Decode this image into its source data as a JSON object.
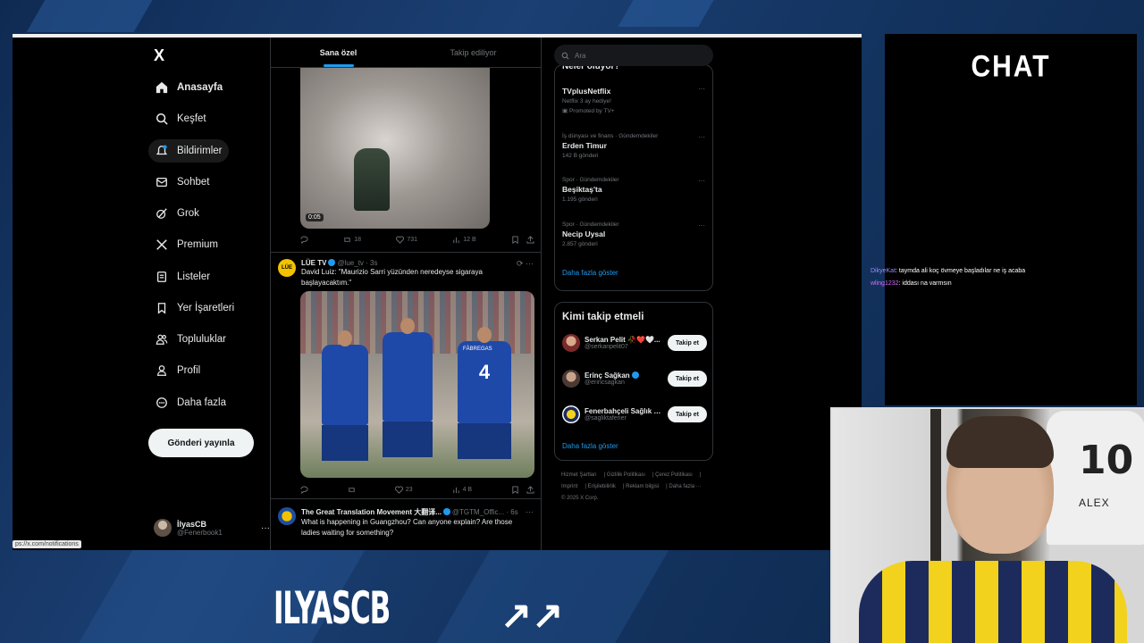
{
  "nav": {
    "logo": "X",
    "items": [
      {
        "label": "Anasayfa",
        "icon": "home-icon"
      },
      {
        "label": "Keşfet",
        "icon": "search-icon"
      },
      {
        "label": "Bildirimler",
        "icon": "bell-icon"
      },
      {
        "label": "Sohbet",
        "icon": "mail-icon"
      },
      {
        "label": "Grok",
        "icon": "grok-icon"
      },
      {
        "label": "Premium",
        "icon": "x-icon"
      },
      {
        "label": "Listeler",
        "icon": "list-icon"
      },
      {
        "label": "Yer İşaretleri",
        "icon": "bookmark-icon"
      },
      {
        "label": "Topluluklar",
        "icon": "people-icon"
      },
      {
        "label": "Profil",
        "icon": "person-icon"
      },
      {
        "label": "Daha fazla",
        "icon": "more-circle-icon"
      }
    ],
    "post_button": "Gönderi yayınla",
    "profile": {
      "name": "İlyasCB",
      "handle": "@Fenerbook1",
      "more": "···"
    }
  },
  "status_url": "ps://x.com/notifications",
  "feed": {
    "tabs": [
      {
        "label": "Sana özel",
        "active": true
      },
      {
        "label": "Takip ediliyor",
        "active": false
      }
    ],
    "tweet1": {
      "video_time": "0:05",
      "reply": "",
      "retweets": "18",
      "likes": "731",
      "views": "12 B"
    },
    "tweet2": {
      "name": "LÜE TV",
      "avatar_text": "LÜE",
      "handle_time": "@lue_tv · 3s",
      "text": "David Luiz: \"Maurizio Sarri yüzünden neredeyse sigaraya başlayacaktım.\"",
      "jersey": "4",
      "jersey_name": "FÀBREGAS",
      "retweets": "",
      "likes": "23",
      "views": "4 B"
    },
    "tweet3": {
      "name": "The Great Translation Movement 大翻译...",
      "handle_time": "@TGTM_Offic... · 6s",
      "text": "What is happening in Guangzhou? Can anyone explain? Are those ladies waiting for something?"
    }
  },
  "right": {
    "search_placeholder": "Ara",
    "trends_title": "Neler oluyor?",
    "trends": [
      {
        "category": "",
        "name": "TVplusNetflix",
        "count": "Netflix 3 ay hediye!",
        "promo": "Promoted by TV+"
      },
      {
        "category": "İş dünyası ve finans · Gündemdekiler",
        "name": "Erden Timur",
        "count": "142 B gönderi"
      },
      {
        "category": "Spor · Gündemdekiler",
        "name": "Beşiktaş'ta",
        "count": "1.195 gönderi"
      },
      {
        "category": "Spor · Gündemdekiler",
        "name": "Necip Uysal",
        "count": "2.857 gönderi"
      }
    ],
    "trends_more": "Daha fazla göster",
    "follow_title": "Kimi takip etmeli",
    "follow": [
      {
        "name": "Serkan Pelit 🥀❤️🤍...",
        "handle": "@serkanpelit07",
        "button": "Takip et"
      },
      {
        "name": "Erinç Sağkan",
        "handle": "@erincsagkan",
        "button": "Takip et"
      },
      {
        "name": "Fenerbahçeli Sağlık Ç...",
        "handle": "@sagliktafener",
        "button": "Takip et"
      }
    ],
    "follow_more": "Daha fazla göster",
    "footer": [
      "Hizmet Şartları",
      "Gizlilik Politikası",
      "Çerez Politikası",
      "Imprint",
      "Erişilebilirlik",
      "Reklam bilgisi",
      "Daha fazla ···",
      "© 2025 X Corp."
    ]
  },
  "chat": {
    "title": "CHAT",
    "messages": [
      {
        "user": "DikyeKat",
        "text": ": taymda ali koç övmeye başladılar ne iş acaba"
      },
      {
        "user": "wling1232",
        "text": ": iddası na varmsın"
      }
    ]
  },
  "cam": {
    "jersey_number": "10",
    "jersey_name": "ALEX"
  },
  "brand": {
    "name": "ILYASCB",
    "logo": "↗↗"
  },
  "colors": {
    "accent": "#1d9bf0",
    "background": "#000000",
    "muted": "#71767b"
  }
}
